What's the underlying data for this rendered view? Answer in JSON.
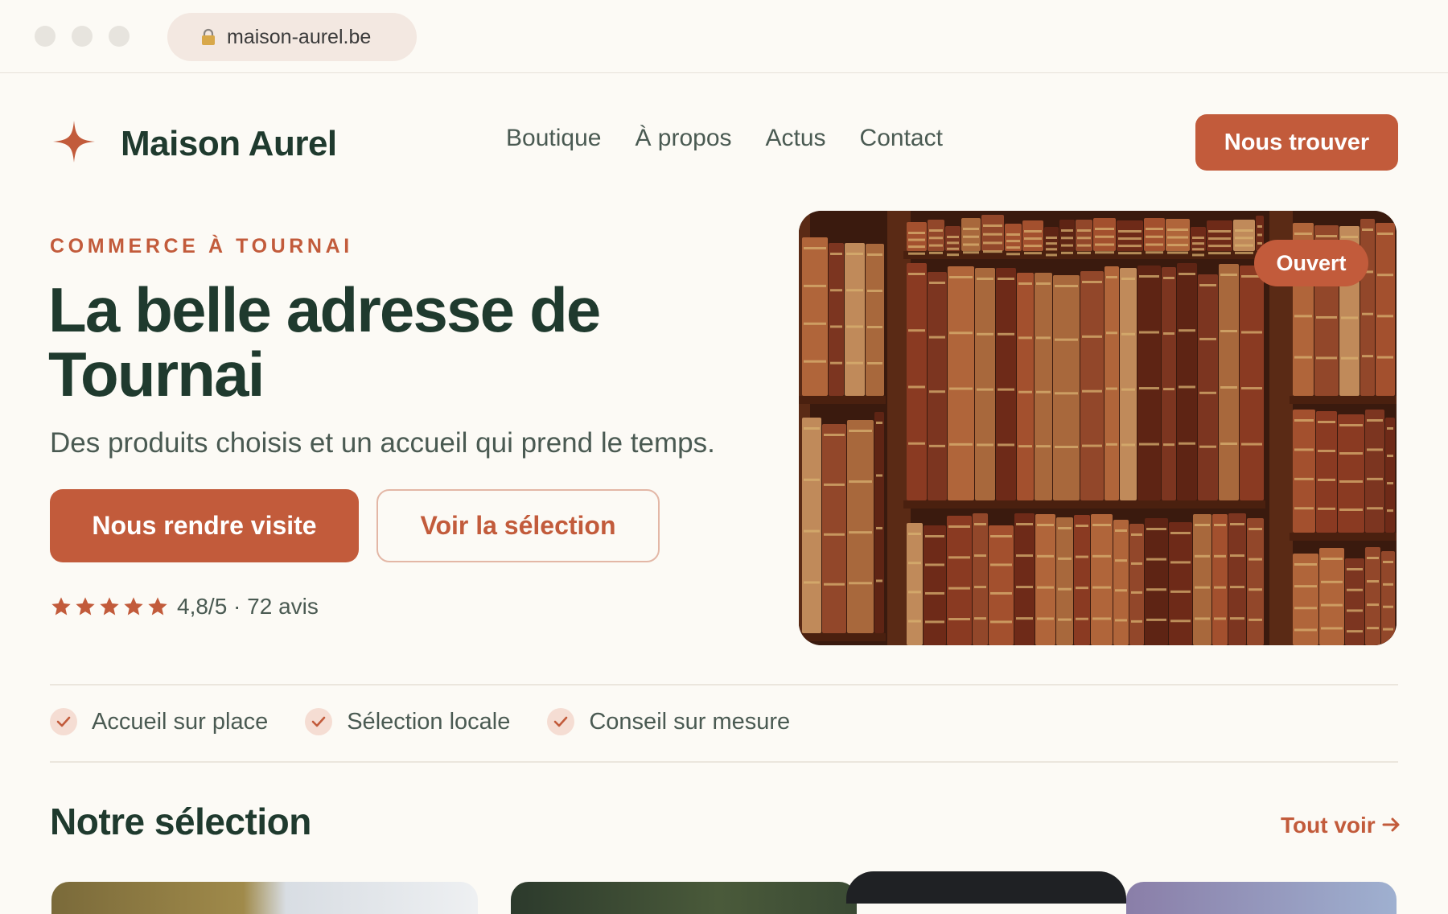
{
  "browser": {
    "url": "maison-aurel.be"
  },
  "header": {
    "brand": "Maison Aurel",
    "nav": [
      "Boutique",
      "À propos",
      "Actus",
      "Contact"
    ],
    "cta": "Nous trouver"
  },
  "hero": {
    "eyebrow": "COMMERCE À TOURNAI",
    "headline": "La belle adresse de Tournai",
    "subtext": "Des produits choisis et un accueil qui prend le temps.",
    "primary_button": "Nous rendre visite",
    "secondary_button": "Voir la sélection",
    "rating": {
      "stars": 5,
      "text": "4,8/5 · 72 avis"
    },
    "status_badge": "Ouvert"
  },
  "features": [
    "Accueil sur place",
    "Sélection locale",
    "Conseil sur mesure"
  ],
  "selection": {
    "title": "Notre sélection",
    "see_all": "Tout voir"
  },
  "colors": {
    "accent": "#c25b3b",
    "heading": "#1f3a2e",
    "background": "#fcfaf5"
  }
}
